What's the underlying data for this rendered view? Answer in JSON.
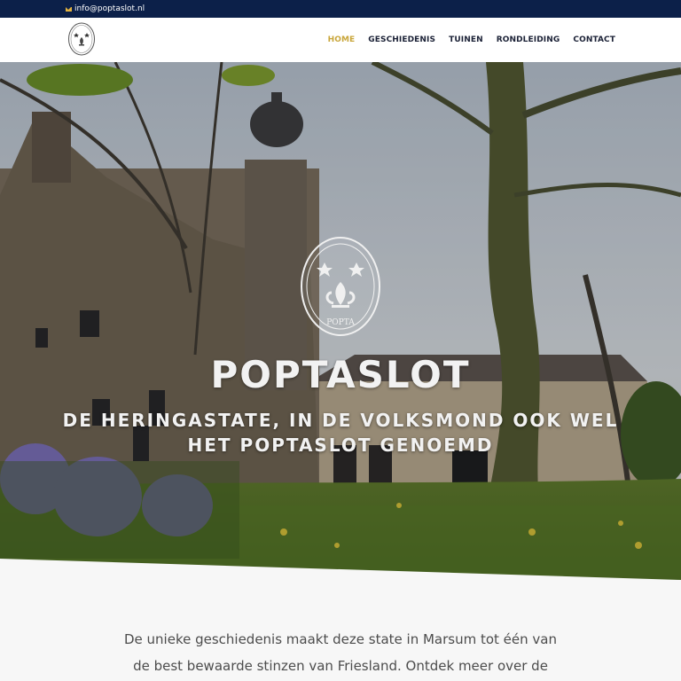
{
  "topbar": {
    "email": "info@poptaslot.nl",
    "icon": "envelope-icon",
    "background": "#0c2049"
  },
  "nav": {
    "items": [
      {
        "label": "HOME",
        "active": true
      },
      {
        "label": "GESCHIEDENIS",
        "active": false
      },
      {
        "label": "TUINEN",
        "active": false
      },
      {
        "label": "RONDLEIDING",
        "active": false
      },
      {
        "label": "CONTACT",
        "active": false
      }
    ],
    "active_color": "#c9a63a"
  },
  "hero": {
    "title": "POPTASLOT",
    "subtitle": "DE HERINGASTATE, IN DE VOLKSMOND OOK WEL HET POPTASLOT GENOEMD",
    "seal_text": "POPTA"
  },
  "intro": {
    "text": "De unieke geschiedenis maakt deze state in Marsum tot één van de best bewaarde stinzen van Friesland. Ontdek meer over de"
  }
}
